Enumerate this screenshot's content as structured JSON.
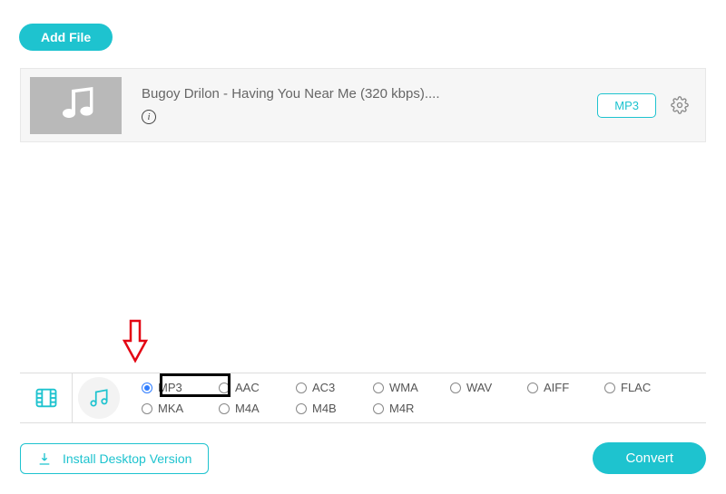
{
  "header": {
    "add_file_label": "Add File"
  },
  "file": {
    "name": "Bugoy Drilon - Having You Near Me (320 kbps)....",
    "format_badge": "MP3"
  },
  "format_bar": {
    "row1": [
      {
        "label": "MP3",
        "checked": true
      },
      {
        "label": "AAC",
        "checked": false
      },
      {
        "label": "AC3",
        "checked": false
      },
      {
        "label": "WMA",
        "checked": false
      },
      {
        "label": "WAV",
        "checked": false
      },
      {
        "label": "AIFF",
        "checked": false
      },
      {
        "label": "FLAC",
        "checked": false
      }
    ],
    "row2": [
      {
        "label": "MKA",
        "checked": false
      },
      {
        "label": "M4A",
        "checked": false
      },
      {
        "label": "M4B",
        "checked": false
      },
      {
        "label": "M4R",
        "checked": false
      }
    ]
  },
  "footer": {
    "install_label": "Install Desktop Version",
    "convert_label": "Convert"
  },
  "colors": {
    "accent": "#1ec3cf",
    "highlight_border": "#000000",
    "arrow": "#e30613"
  }
}
